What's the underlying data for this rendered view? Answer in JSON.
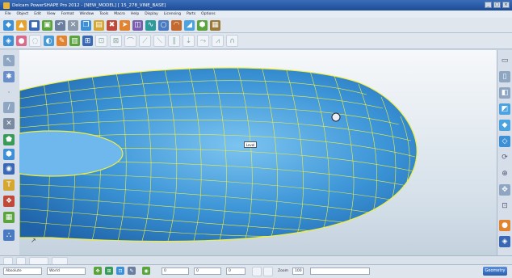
{
  "window": {
    "title": "Delcam PowerSHAPE Pro 2012 - [NEW_MODEL] [ 15_278_VINE_BASE]",
    "buttons": [
      "_",
      "□",
      "×"
    ]
  },
  "menu": [
    "File",
    "Object",
    "Edit",
    "View",
    "Format",
    "Window",
    "Tools",
    "Macro",
    "Help",
    "Display",
    "Licensing",
    "Parts",
    "Options"
  ],
  "viewport": {
    "tooltip_text": "Level",
    "colors": {
      "surface": "#4da3e0",
      "mesh": "#f1ef3c",
      "background": "#e6edf3"
    }
  },
  "toolbar1_icons": [
    "new-icon",
    "open-icon",
    "save-icon",
    "print-icon",
    "undo-icon",
    "cut-icon",
    "copy-icon",
    "paste-icon",
    "delete-icon",
    "select-icon",
    "wireframe-icon",
    "curve-icon",
    "circle-icon",
    "arc-icon",
    "surface-icon",
    "solid-icon",
    "mesh-icon"
  ],
  "status": {
    "coord_mode": "Absolute",
    "workplane": "World",
    "field_a": "0",
    "field_b": "0",
    "field_c": "0",
    "zoom_label": "Zoom",
    "zoom_value": "100",
    "geometry_button": "Geometry"
  }
}
